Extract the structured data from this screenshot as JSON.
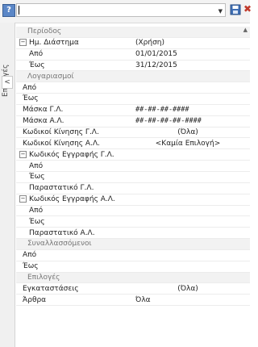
{
  "toolbar": {
    "help_glyph": "?",
    "combo_value": "",
    "close_glyph": "✖"
  },
  "sidetab": {
    "label": "Επιλογές",
    "toggle_glyph": "<"
  },
  "grid": {
    "rows": [
      {
        "label": "Περίοδος",
        "value": "",
        "kind": "section"
      },
      {
        "label": "Ημ. Διάστημα",
        "value": "(Χρήση)",
        "kind": "group"
      },
      {
        "label": "Από",
        "value": "01/01/2015",
        "kind": "child"
      },
      {
        "label": "Έως",
        "value": "31/12/2015",
        "kind": "child"
      },
      {
        "label": "Λογαριασμοί",
        "value": "",
        "kind": "section"
      },
      {
        "label": "Από",
        "value": "",
        "kind": "plain"
      },
      {
        "label": "Έως",
        "value": "",
        "kind": "plain"
      },
      {
        "label": "Μάσκα Γ.Λ.",
        "value": "##-##-##-####",
        "kind": "mono"
      },
      {
        "label": "Μάσκα Α.Λ.",
        "value": "##-##-##-##-####",
        "kind": "mono"
      },
      {
        "label": "Κωδικοί Κίνησης Γ.Λ.",
        "value": "(Όλα)",
        "kind": "center"
      },
      {
        "label": "Κωδικοί Κίνησης Α.Λ.",
        "value": "<Καμία Επιλογή>",
        "kind": "center"
      },
      {
        "label": "Κωδικός Εγγραφής Γ.Λ.",
        "value": "",
        "kind": "group"
      },
      {
        "label": "Από",
        "value": "",
        "kind": "child"
      },
      {
        "label": "Έως",
        "value": "",
        "kind": "child"
      },
      {
        "label": "Παραστατικό Γ.Λ.",
        "value": "",
        "kind": "child"
      },
      {
        "label": "Κωδικός Εγγραφής Α.Λ.",
        "value": "",
        "kind": "group"
      },
      {
        "label": "Από",
        "value": "",
        "kind": "child"
      },
      {
        "label": "Έως",
        "value": "",
        "kind": "child"
      },
      {
        "label": "Παραστατικό Α.Λ.",
        "value": "",
        "kind": "child"
      },
      {
        "label": "Συναλλασσόμενοι",
        "value": "",
        "kind": "section"
      },
      {
        "label": "Από",
        "value": "",
        "kind": "plain"
      },
      {
        "label": "Έως",
        "value": "",
        "kind": "plain"
      },
      {
        "label": "Επιλογές",
        "value": "",
        "kind": "section"
      },
      {
        "label": "Εγκαταστάσεις",
        "value": "(Όλα)",
        "kind": "center"
      },
      {
        "label": "Άρθρα",
        "value": "Όλα",
        "kind": "plain"
      }
    ]
  },
  "colors": {
    "section_bg": "#f2f2f2",
    "grid_line": "#ececec",
    "close_red": "#c0392b"
  }
}
